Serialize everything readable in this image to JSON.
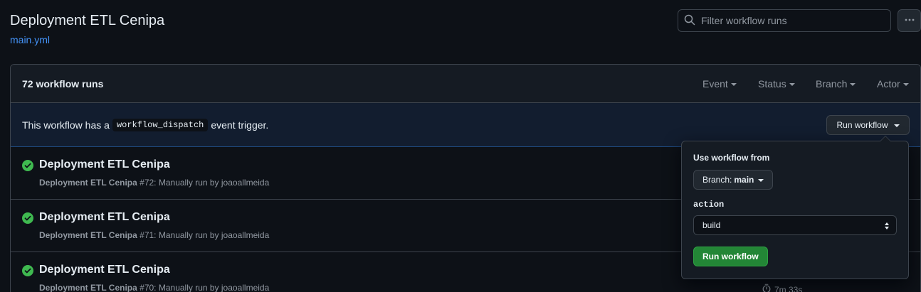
{
  "header": {
    "title": "Deployment ETL Cenipa",
    "file_link": "main.yml",
    "search_placeholder": "Filter workflow runs",
    "more_icon": "kebab-horizontal-icon"
  },
  "runs_box": {
    "count_label": "72 workflow runs",
    "filters": [
      "Event",
      "Status",
      "Branch",
      "Actor"
    ],
    "dispatch": {
      "text_before": "This workflow has a",
      "code": "workflow_dispatch",
      "text_after": "event trigger.",
      "button_label": "Run workflow"
    },
    "runs": [
      {
        "title": "Deployment ETL Cenipa",
        "workflow": "Deployment ETL Cenipa",
        "detail": "#72: Manually run by joaoallmeida",
        "status": "success"
      },
      {
        "title": "Deployment ETL Cenipa",
        "workflow": "Deployment ETL Cenipa",
        "detail": "#71: Manually run by joaoallmeida",
        "status": "success"
      },
      {
        "title": "Deployment ETL Cenipa",
        "workflow": "Deployment ETL Cenipa",
        "detail": "#70: Manually run by joaoallmeida",
        "status": "success",
        "duration": "7m 33s"
      }
    ]
  },
  "popover": {
    "use_from_label": "Use workflow from",
    "branch_prefix": "Branch:",
    "branch_value": "main",
    "input_label": "action",
    "input_value": "build",
    "submit_label": "Run workflow"
  },
  "colors": {
    "background": "#0d1117",
    "success": "#3fb950",
    "accent_link": "#4493f8",
    "primary_button": "#238636"
  }
}
